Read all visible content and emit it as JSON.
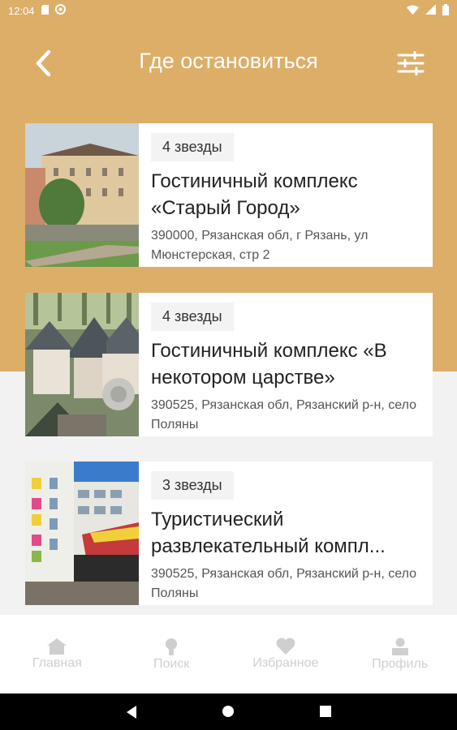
{
  "status": {
    "time": "12:04"
  },
  "header": {
    "title": "Где остановиться"
  },
  "hotels": [
    {
      "stars": "4 звезды",
      "name": "Гостиничный комплекс «Старый Город»",
      "address": "390000, Рязанская обл, г Рязань, ул Мюнстерская, стр 2"
    },
    {
      "stars": "4 звезды",
      "name": "Гостиничный комплекс «В некотором царстве»",
      "address": "390525, Рязанская обл, Рязанский р-н, село Поляны"
    },
    {
      "stars": "3 звезды",
      "name": "Туристический развлекательный компл...",
      "address": "390525, Рязанская обл, Рязанский р-н, село Поляны"
    }
  ],
  "bottom_nav": {
    "home": "Главная",
    "search": "Поиск",
    "favorites": "Избранное",
    "profile": "Профиль"
  },
  "colors": {
    "accent": "#dcae68",
    "nav_inactive": "#cfcfcf"
  }
}
